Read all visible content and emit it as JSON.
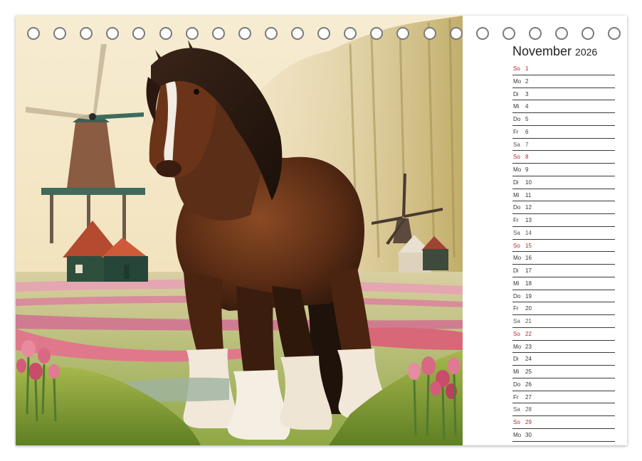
{
  "calendar": {
    "month": "November",
    "year": "2026",
    "colors": {
      "sunday": "#b0282e",
      "weekday": "#333333",
      "line": "#3a3a3a"
    },
    "days": [
      {
        "wd": "So",
        "d": "1",
        "type": "sunday"
      },
      {
        "wd": "Mo",
        "d": "2",
        "type": "weekday"
      },
      {
        "wd": "Di",
        "d": "3",
        "type": "weekday"
      },
      {
        "wd": "Mi",
        "d": "4",
        "type": "weekday"
      },
      {
        "wd": "Do",
        "d": "5",
        "type": "weekday"
      },
      {
        "wd": "Fr",
        "d": "6",
        "type": "weekday"
      },
      {
        "wd": "Sa",
        "d": "7",
        "type": "saturday"
      },
      {
        "wd": "So",
        "d": "8",
        "type": "sunday"
      },
      {
        "wd": "Mo",
        "d": "9",
        "type": "weekday"
      },
      {
        "wd": "Di",
        "d": "10",
        "type": "weekday"
      },
      {
        "wd": "Mi",
        "d": "11",
        "type": "weekday"
      },
      {
        "wd": "Do",
        "d": "12",
        "type": "weekday"
      },
      {
        "wd": "Fr",
        "d": "13",
        "type": "weekday"
      },
      {
        "wd": "Sa",
        "d": "14",
        "type": "saturday"
      },
      {
        "wd": "So",
        "d": "15",
        "type": "sunday"
      },
      {
        "wd": "Mo",
        "d": "16",
        "type": "weekday"
      },
      {
        "wd": "Di",
        "d": "17",
        "type": "weekday"
      },
      {
        "wd": "Mi",
        "d": "18",
        "type": "weekday"
      },
      {
        "wd": "Do",
        "d": "19",
        "type": "weekday"
      },
      {
        "wd": "Fr",
        "d": "20",
        "type": "weekday"
      },
      {
        "wd": "Sa",
        "d": "21",
        "type": "saturday"
      },
      {
        "wd": "So",
        "d": "22",
        "type": "sunday"
      },
      {
        "wd": "Mo",
        "d": "23",
        "type": "weekday"
      },
      {
        "wd": "Di",
        "d": "24",
        "type": "weekday"
      },
      {
        "wd": "Mi",
        "d": "25",
        "type": "weekday"
      },
      {
        "wd": "Do",
        "d": "26",
        "type": "weekday"
      },
      {
        "wd": "Fr",
        "d": "27",
        "type": "weekday"
      },
      {
        "wd": "Sa",
        "d": "28",
        "type": "saturday"
      },
      {
        "wd": "So",
        "d": "29",
        "type": "sunday"
      },
      {
        "wd": "Mo",
        "d": "30",
        "type": "weekday"
      }
    ]
  },
  "binding": {
    "ring_count": 23,
    "icon": "spiral-ring-icon"
  },
  "photo": {
    "subject": "horse-with-windmills-image"
  }
}
